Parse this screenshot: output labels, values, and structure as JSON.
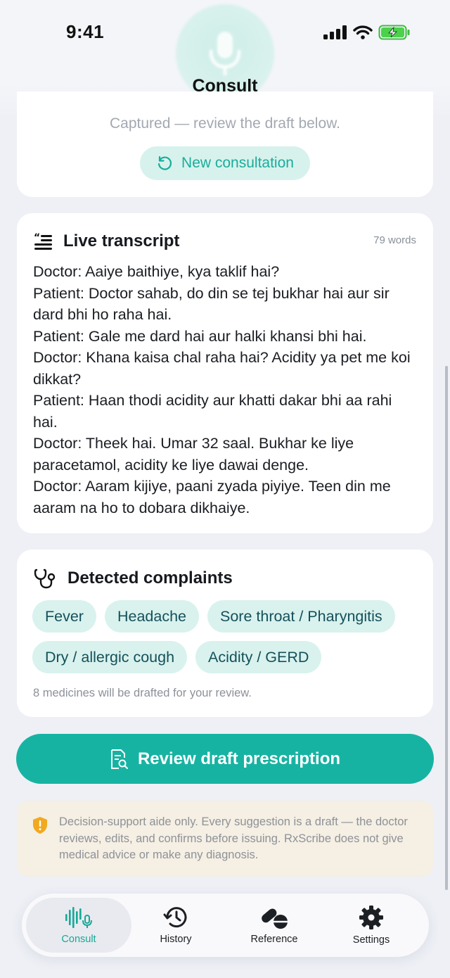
{
  "status_bar": {
    "time": "9:41",
    "icons": [
      "cellular-signal-icon",
      "wifi-icon",
      "battery-charging-icon"
    ]
  },
  "header": {
    "title": "Consult",
    "mic_icon": "microphone-icon"
  },
  "capture": {
    "status_text": "Captured — review the draft below.",
    "new_consultation_label": "New consultation"
  },
  "transcript": {
    "title": "Live transcript",
    "word_count": "79 words",
    "lines": [
      "Doctor: Aaiye baithiye, kya taklif hai?",
      "Patient: Doctor sahab, do din se tej bukhar hai aur sir dard bhi ho raha hai.",
      "Patient: Gale me dard hai aur halki khansi bhi hai.",
      "Doctor: Khana kaisa chal raha hai? Acidity ya pet me koi dikkat?",
      "Patient: Haan thodi acidity aur khatti dakar bhi aa rahi hai.",
      "Doctor: Theek hai. Umar 32 saal. Bukhar ke liye paracetamol, acidity ke liye dawai denge.",
      "Doctor: Aaram kijiye, paani zyada piyiye. Teen din me aaram na ho to dobara dikhaiye."
    ]
  },
  "complaints": {
    "title": "Detected complaints",
    "chips": [
      "Fever",
      "Headache",
      "Sore throat / Pharyngitis",
      "Dry / allergic cough",
      "Acidity / GERD"
    ],
    "note": "8 medicines will be drafted for your review."
  },
  "review_button": {
    "label": "Review draft prescription"
  },
  "disclaimer": {
    "text": "Decision-support aide only. Every suggestion is a draft — the doctor reviews, edits, and confirms before issuing. RxScribe does not give medical advice or make any diagnosis."
  },
  "tabs": [
    {
      "label": "Consult",
      "icon": "waveform-mic-icon",
      "active": true
    },
    {
      "label": "History",
      "icon": "history-clock-icon",
      "active": false
    },
    {
      "label": "Reference",
      "icon": "pills-icon",
      "active": false
    },
    {
      "label": "Settings",
      "icon": "gear-icon",
      "active": false
    }
  ],
  "colors": {
    "accent": "#17b3a2",
    "chip_bg": "#d9f2ee",
    "chip_text": "#15505a",
    "background": "#eef0f6",
    "warning": "#f2a91e"
  }
}
